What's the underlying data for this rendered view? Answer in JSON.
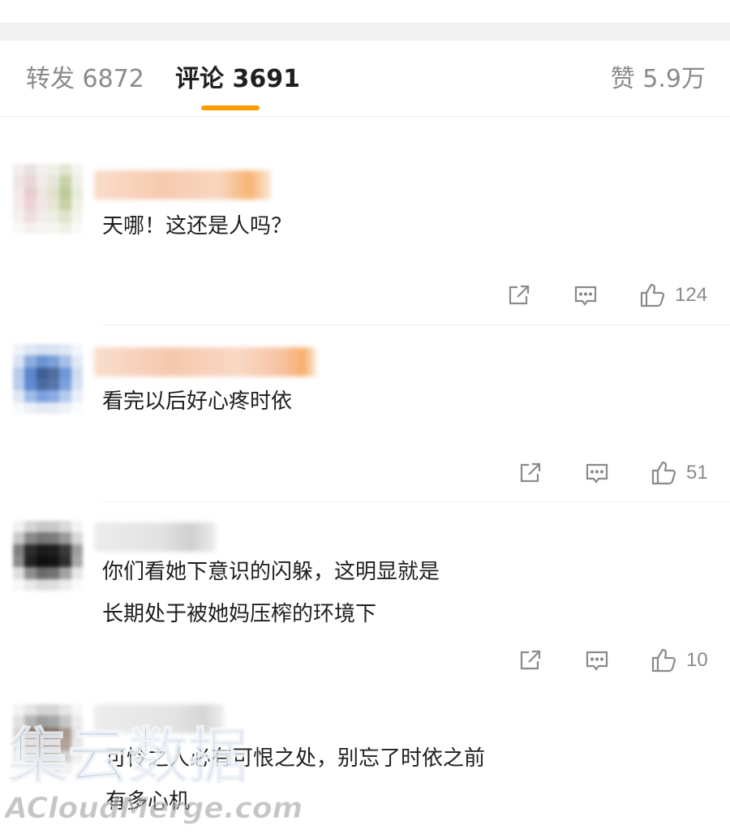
{
  "tabs": {
    "repost": "转发 6872",
    "comments": "评论 3691",
    "likes": "赞 5.9万"
  },
  "comments": [
    {
      "text_lines": [
        "天哪！这还是人吗？"
      ],
      "likes": "124"
    },
    {
      "text_lines": [
        "看完以后好心疼时依"
      ],
      "likes": "51"
    },
    {
      "text_lines": [
        "你们看她下意识的闪躲，这明显就是",
        "长期处于被她妈压榨的环境下"
      ],
      "likes": "10"
    },
    {
      "text_lines": [
        "可怜之人必有可恨之处，别忘了时依之前",
        "有多心机"
      ]
    }
  ],
  "icons": [
    "share-icon",
    "reply-icon",
    "thumbs-up-icon"
  ],
  "colors": {
    "accent": "#ff9d00",
    "muted": "#8a8a8a"
  },
  "watermark": {
    "line1": "集云数据",
    "line2": "ACloudMerge.com"
  }
}
